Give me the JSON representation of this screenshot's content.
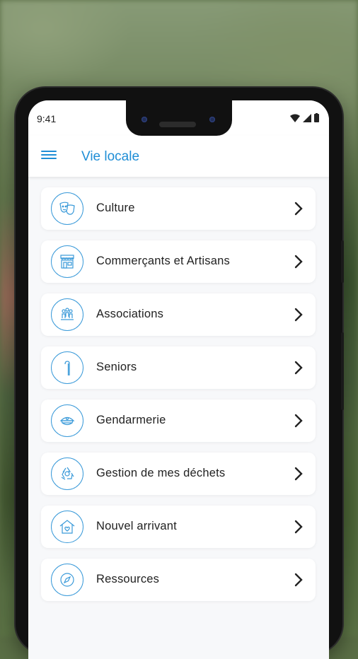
{
  "status_bar": {
    "time": "9:41"
  },
  "header": {
    "title": "Vie locale"
  },
  "menu_items": [
    {
      "label": "Culture",
      "icon": "theater-masks-icon"
    },
    {
      "label": "Commerçants et Artisans",
      "icon": "storefront-icon"
    },
    {
      "label": "Associations",
      "icon": "people-group-icon"
    },
    {
      "label": "Seniors",
      "icon": "walking-cane-icon"
    },
    {
      "label": "Gendarmerie",
      "icon": "police-cap-icon"
    },
    {
      "label": "Gestion de mes déchets",
      "icon": "recycle-icon"
    },
    {
      "label": "Nouvel arrivant",
      "icon": "home-heart-icon"
    },
    {
      "label": "Ressources",
      "icon": "compass-icon"
    }
  ],
  "colors": {
    "accent": "#1f8ed6",
    "icon_stroke": "#3a9ad9",
    "text": "#222222"
  }
}
